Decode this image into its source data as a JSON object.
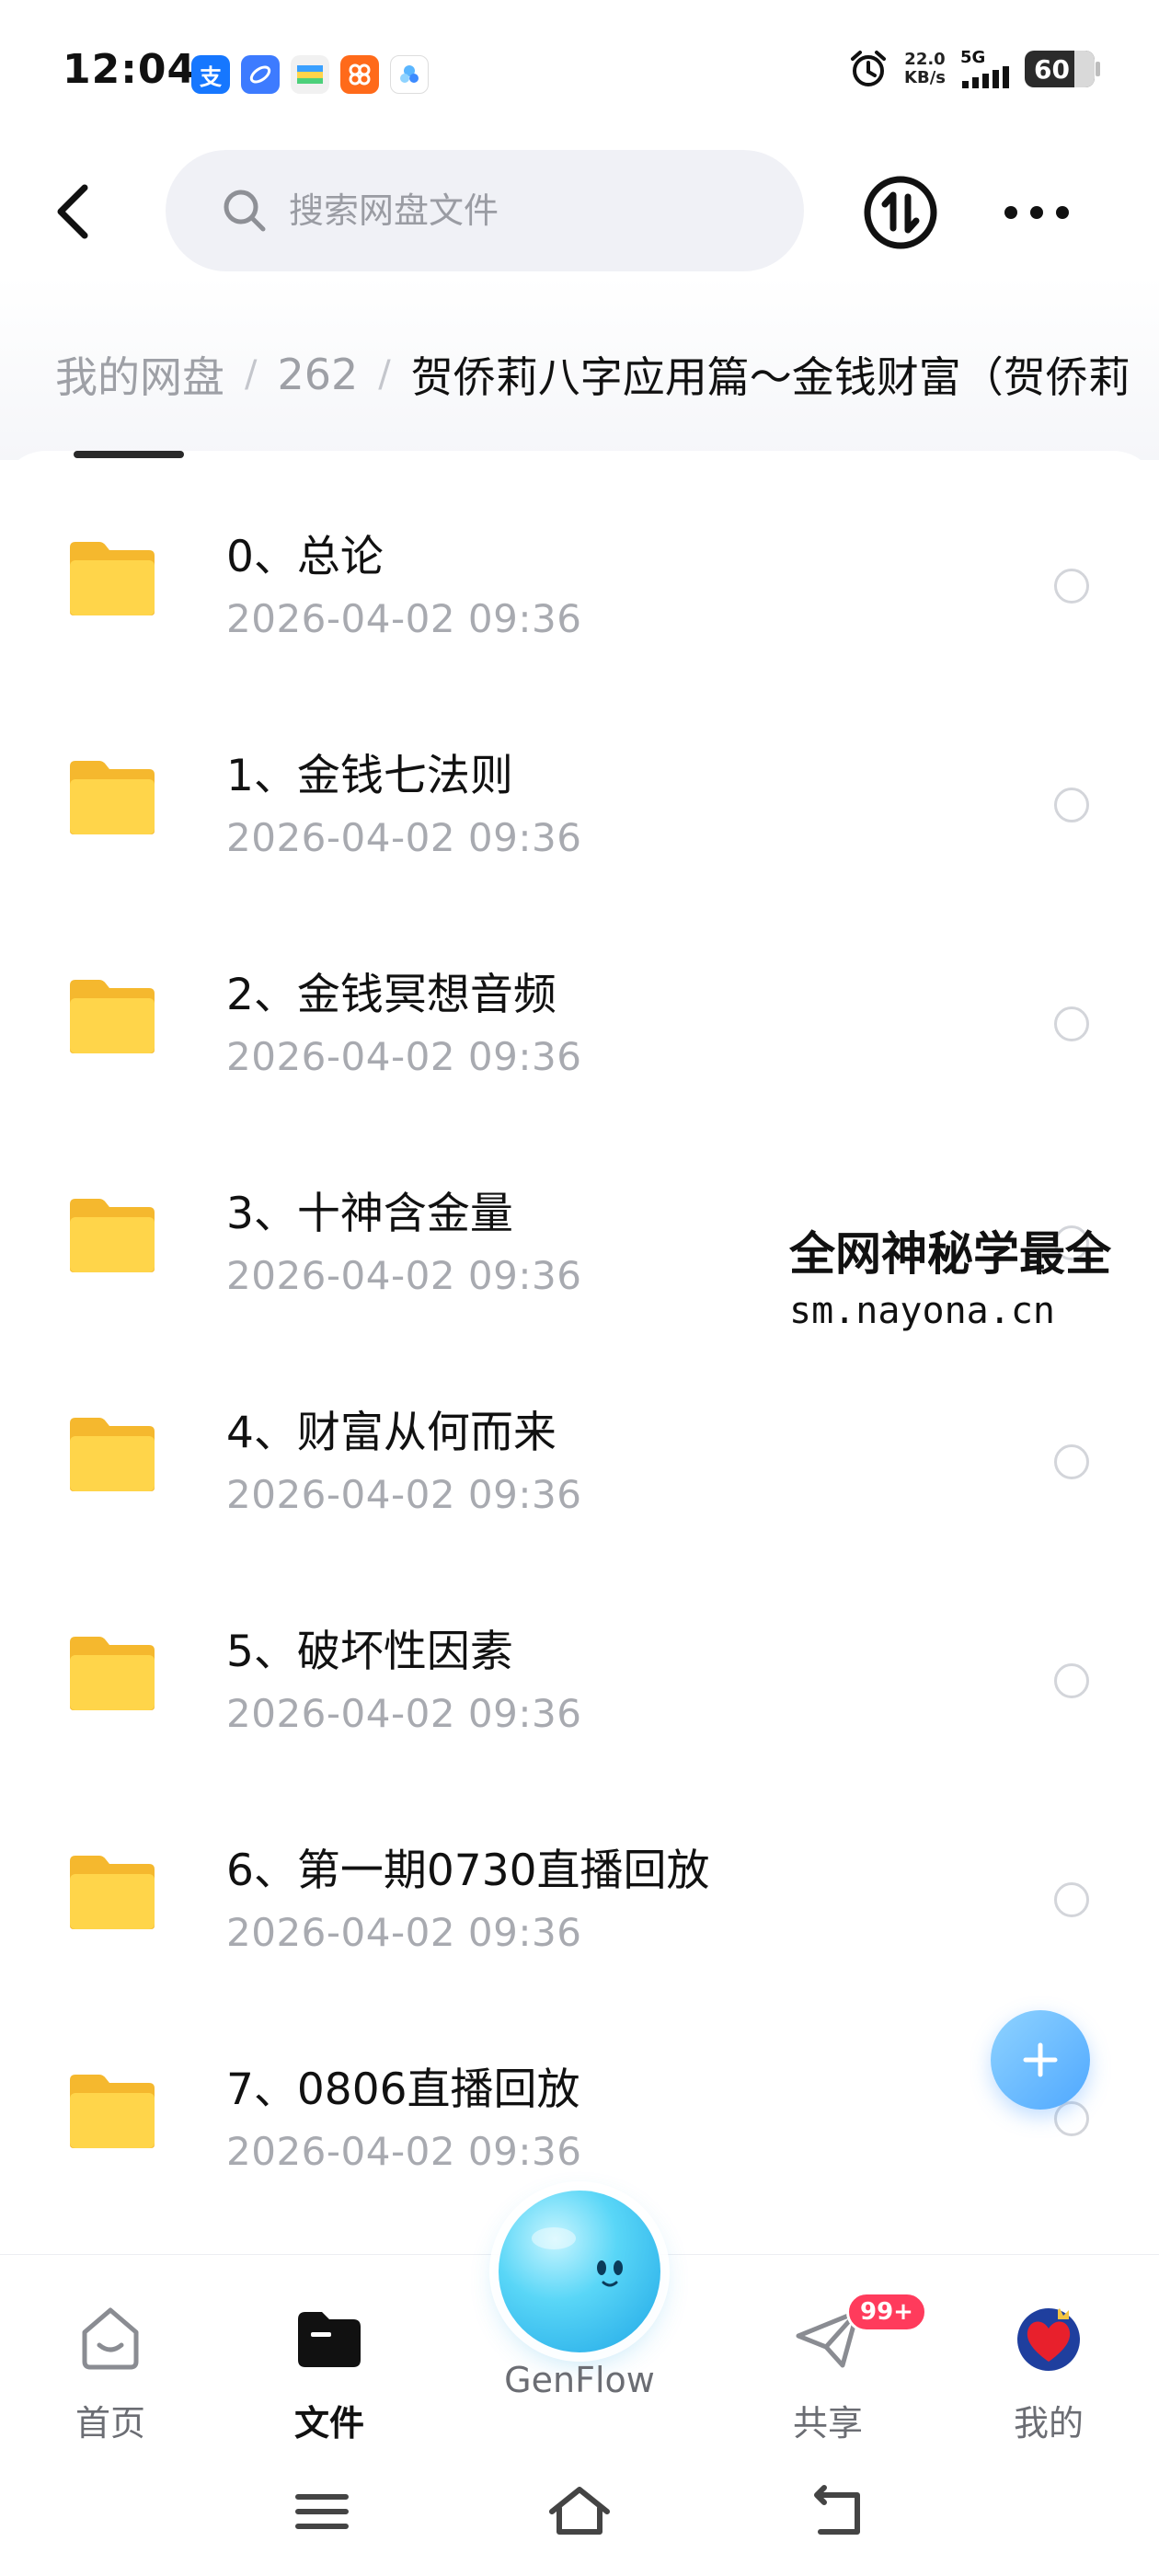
{
  "status_bar": {
    "time": "12:04",
    "apps": [
      {
        "name": "alipay",
        "glyph": "支",
        "color": "#1677ff"
      },
      {
        "name": "app-blue",
        "glyph": "",
        "color": "#3d7bff"
      },
      {
        "name": "app-card",
        "glyph": "",
        "color": "#f3f3f3"
      },
      {
        "name": "app-orange",
        "glyph": "器",
        "color": "#ff6a1a"
      },
      {
        "name": "genflow-app",
        "glyph": "",
        "color": "#ffffff"
      }
    ],
    "net_speed_value": "22.0",
    "net_speed_unit": "KB/s",
    "network": "5G",
    "battery": "60"
  },
  "header": {
    "search_placeholder": "搜索网盘文件"
  },
  "breadcrumb": {
    "root": "我的网盘",
    "level1": "262",
    "current": "贺侨莉八字应用篇～金钱财富（贺侨莉"
  },
  "files": [
    {
      "name": "0、总论",
      "date": "2026-04-02  09:36"
    },
    {
      "name": "1、金钱七法则",
      "date": "2026-04-02  09:36"
    },
    {
      "name": "2、金钱冥想音频",
      "date": "2026-04-02  09:36"
    },
    {
      "name": "3、十神含金量",
      "date": "2026-04-02  09:36"
    },
    {
      "name": "4、财富从何而来",
      "date": "2026-04-02  09:36"
    },
    {
      "name": "5、破坏性因素",
      "date": "2026-04-02  09:36"
    },
    {
      "name": "6、第一期0730直播回放",
      "date": "2026-04-02  09:36"
    },
    {
      "name": "7、0806直播回放",
      "date": "2026-04-02  09:36"
    }
  ],
  "watermark": {
    "title": "全网神秘学最全",
    "url": "sm.nayona.cn"
  },
  "bottom_nav": {
    "home": "首页",
    "files": "文件",
    "genflow": "GenFlow",
    "share": "共享",
    "share_badge": "99+",
    "mine": "我的"
  },
  "colors": {
    "accent": "#4fa8ff",
    "folder": "#ffd54a",
    "badge": "#ff3b5c"
  }
}
